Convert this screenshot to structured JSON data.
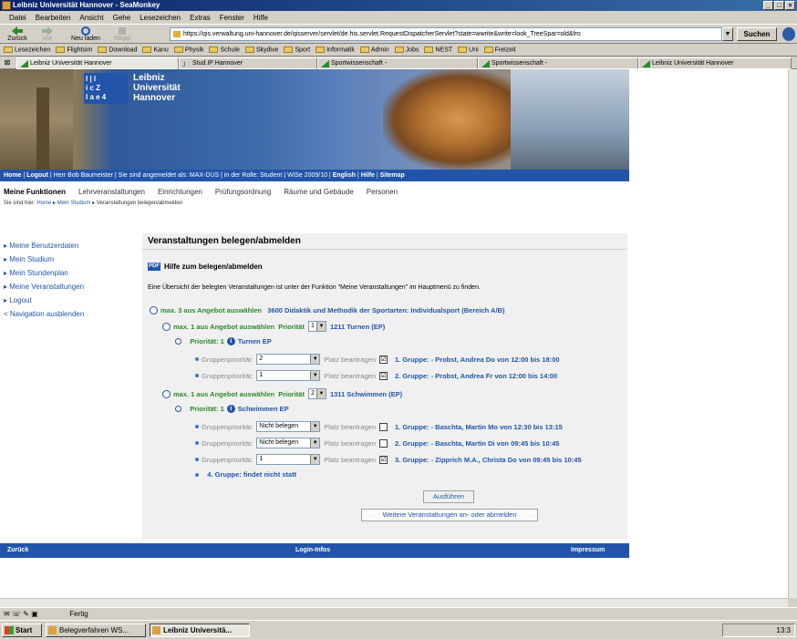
{
  "window": {
    "title": "Leibniz Universität Hannover - SeaMonkey"
  },
  "menu": [
    "Datei",
    "Bearbeiten",
    "Ansicht",
    "Gehe",
    "Lesezeichen",
    "Extras",
    "Fenster",
    "Hilfe"
  ],
  "toolbar": {
    "back": "Zurück",
    "forward": "Vor",
    "reload": "Neu laden",
    "stop": "Stopp",
    "url": "https://qis.verwaltung.uni-hannover.de/qisserver/servlet/de.his.servlet.RequestDispatcherServlet?state=wwrite&write=look_TreeSpar=old&fro",
    "search": "Suchen"
  },
  "bookmarks": [
    "Lesezeichen",
    "Flightsim",
    "Download",
    "Kanu",
    "Physik",
    "Schule",
    "Skydive",
    "Sport",
    "Informatik",
    "Admin",
    "Jobs",
    "NEST",
    "Uni",
    "Freizeit"
  ],
  "tabs": [
    "Leibniz Universität Hannover",
    "Stud.IP Hannover",
    "Sportwissenschaft -",
    "Sportwissenschaft -",
    "Leibniz Universität Hannover"
  ],
  "banner": {
    "logo_lines": [
      "l | l",
      "i c Z",
      "l a e 4"
    ],
    "name_lines": [
      "Leibniz",
      "Universität",
      "Hannover"
    ]
  },
  "userbar": {
    "home": "Home",
    "logout": "Logout",
    "text": "Herr Bob Baumeister | Sie sind angemeldet als: MAX-DUS | in der Rolle: Student | WiSe 2009/10 |",
    "english": "English",
    "hilfe": "Hilfe",
    "sitemap": "Sitemap"
  },
  "funcnav": {
    "title": "Meine Funktionen",
    "items": [
      "Lehrveranstaltungen",
      "Einrichtungen",
      "Prüfungsordnung",
      "Räume und Gebäude",
      "Personen"
    ]
  },
  "breadcrumb": {
    "prefix": "Sie sind hier:",
    "home": "Home",
    "studium": "Mein Studium",
    "current": "Veranstaltungen belegen/abmelden"
  },
  "leftnav": [
    "Meine Benutzerdaten",
    "Mein Studium",
    "Mein Stundenplan",
    "Meine Veranstaltungen",
    "Logout",
    "Navigation ausblenden"
  ],
  "content": {
    "title": "Veranstaltungen belegen/abmelden",
    "help": "Hilfe zum belegen/abmelden",
    "pdf_label": "PDF",
    "intro": "Eine Übersicht der belegten Veranstaltungen ist unter der Funktion \"Meine Veranstaltungen\" im Hauptmenü zu finden.",
    "top": {
      "label": "max. 3 aus Angebot auswählen",
      "course": "3600 Didaktik und Methodik der Sportarten: Individualsport (Bereich A/B)"
    },
    "block1": {
      "label": "max. 1 aus Angebot auswählen",
      "prio_label": "Priorität",
      "prio": "1",
      "course": "1211 Turnen (EP)",
      "sub_prio": "Priorität: 1",
      "sub_name": "Turnen EP",
      "groups": [
        {
          "gp_label": "Gruppenpriorität:",
          "gp": "2",
          "platz": "Platz beantragen",
          "checked": "☑",
          "text": "1. Gruppe: - Probst, Andrea Do von 12:00 bis 18:00"
        },
        {
          "gp_label": "Gruppenpriorität:",
          "gp": "1",
          "platz": "Platz beantragen",
          "checked": "☑",
          "text": "2. Gruppe: - Probst, Andrea Fr von 12:00 bis 14:00"
        }
      ]
    },
    "block2": {
      "label": "max. 1 aus Angebot auswählen",
      "prio_label": "Priorität",
      "prio": "2",
      "course": "1311 Schwimmen (EP)",
      "sub_prio": "Priorität: 1",
      "sub_name": "Schwimmen EP",
      "groups": [
        {
          "gp_label": "Gruppenpriorität:",
          "gp": "Nicht belegen",
          "platz": "Platz beantragen",
          "checked": "",
          "text": "1. Gruppe: - Baschta, Martin Mo von 12:30 bis 13:15"
        },
        {
          "gp_label": "Gruppenpriorität:",
          "gp": "Nicht belegen",
          "platz": "Platz beantragen",
          "checked": "",
          "text": "2. Gruppe: - Baschta, Martin Di von 09:45 bis 10:45"
        },
        {
          "gp_label": "Gruppenpriorität:",
          "gp": "1",
          "platz": "Platz beantragen",
          "checked": "☑",
          "text": "3. Gruppe: - Zipprich M.A., Christa Do von 09:45 bis 10:45"
        }
      ],
      "no_group": "4. Gruppe: findet nicht statt"
    },
    "execute": "Ausführen",
    "more": "Weitere Veranstaltungen an- oder abmelden"
  },
  "footer": {
    "back": "Zurück",
    "login": "Login-Infos",
    "impressum": "Impressum"
  },
  "status": {
    "text": "Fertig"
  },
  "taskbar": {
    "start": "Start",
    "tasks": [
      "Belegverfahren WS...",
      "Leibniz Universitä..."
    ],
    "clock": "13:3"
  }
}
